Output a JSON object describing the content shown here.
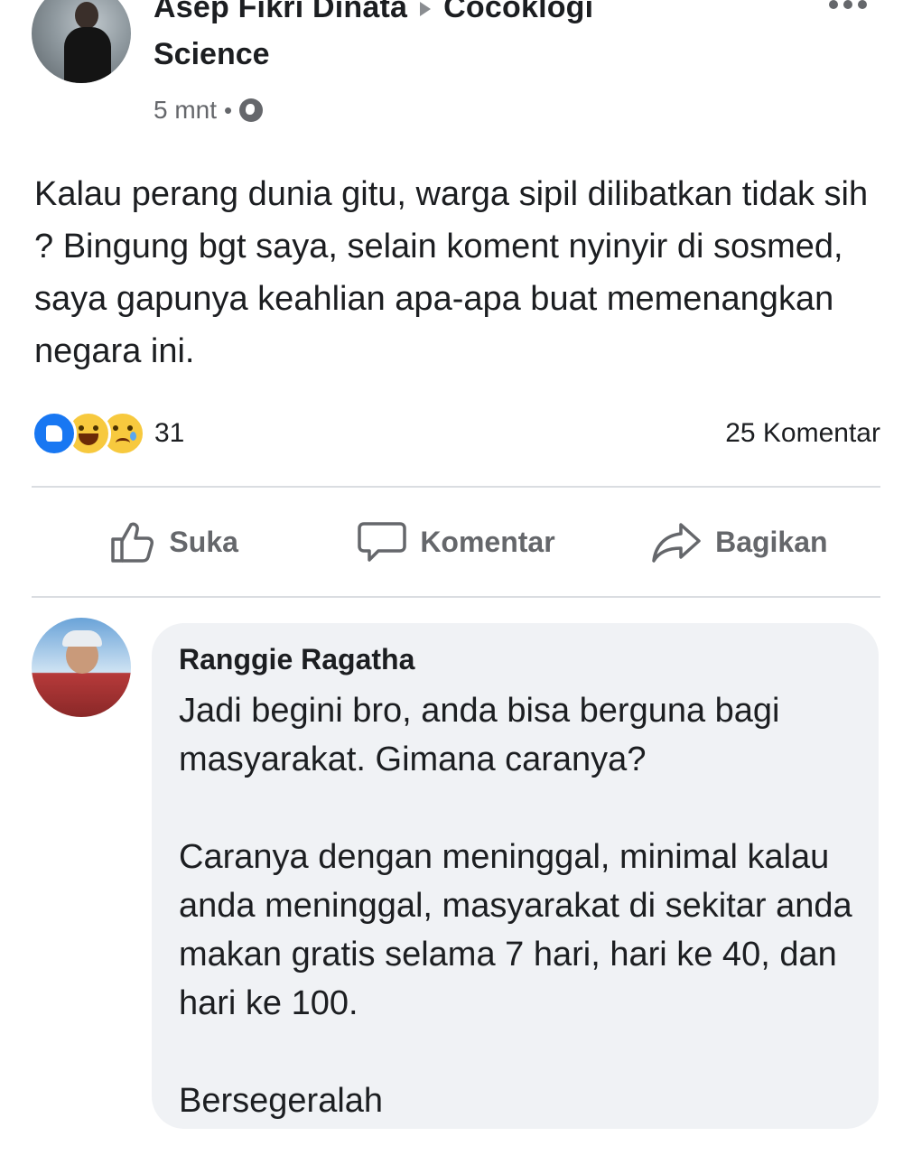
{
  "post": {
    "author": "Asep Fikri Dinata",
    "group": "Cocoklogi",
    "group_line2": "Science",
    "time": "5 mnt",
    "separator": "•",
    "privacy_icon": "globe-icon",
    "more_icon": "more-icon",
    "body": "Kalau perang dunia gitu, warga sipil dilibatkan tidak sih ? Bingung bgt saya, selain koment nyinyir di sosmed, saya gapunya keahlian apa-apa buat memenangkan negara ini."
  },
  "reactions": {
    "icons": [
      "like-icon",
      "haha-icon",
      "sad-icon"
    ],
    "count": "31",
    "comments": "25 Komentar"
  },
  "actions": {
    "like_label": "Suka",
    "comment_label": "Komentar",
    "share_label": "Bagikan"
  },
  "comment": {
    "name": "Ranggie Ragatha",
    "paragraphs": [
      "Jadi begini bro, anda bisa berguna bagi masyarakat. Gimana caranya?",
      "Caranya dengan meninggal, minimal kalau anda meninggal, masyarakat di sekitar anda makan gratis selama 7 hari, hari ke 40, dan hari ke 100.",
      "Bersegeralah"
    ]
  },
  "colors": {
    "text": "#1c1e21",
    "secondary": "#65676b",
    "like_blue": "#1877f2",
    "bubble": "#f0f2f5",
    "divider": "#dadde1"
  }
}
